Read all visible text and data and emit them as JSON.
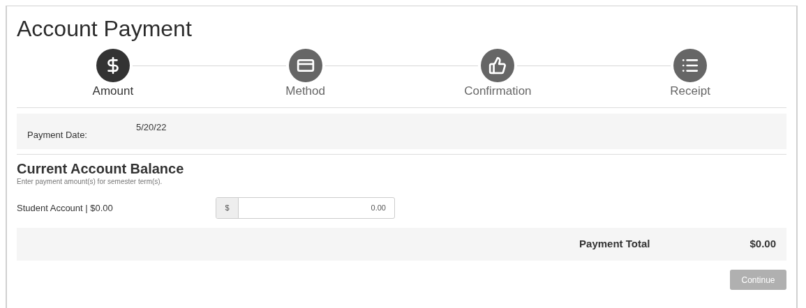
{
  "title": "Account Payment",
  "steps": [
    {
      "label": "Amount",
      "kind": "dollar",
      "selected": true
    },
    {
      "label": "Method",
      "kind": "card",
      "selected": false
    },
    {
      "label": "Confirmation",
      "kind": "thumb",
      "selected": false
    },
    {
      "label": "Receipt",
      "kind": "list",
      "selected": false
    }
  ],
  "payment_date": {
    "label": "Payment Date:",
    "value": "5/20/22"
  },
  "balance": {
    "heading": "Current Account Balance",
    "hint": "Enter payment amount(s) for semester term(s).",
    "rows": [
      {
        "label": "Student Account | $0.00",
        "prefix": "$",
        "value": "0.00"
      }
    ]
  },
  "total": {
    "label": "Payment Total",
    "value": "$0.00"
  },
  "continue_button": {
    "label": "Continue",
    "disabled": true
  }
}
